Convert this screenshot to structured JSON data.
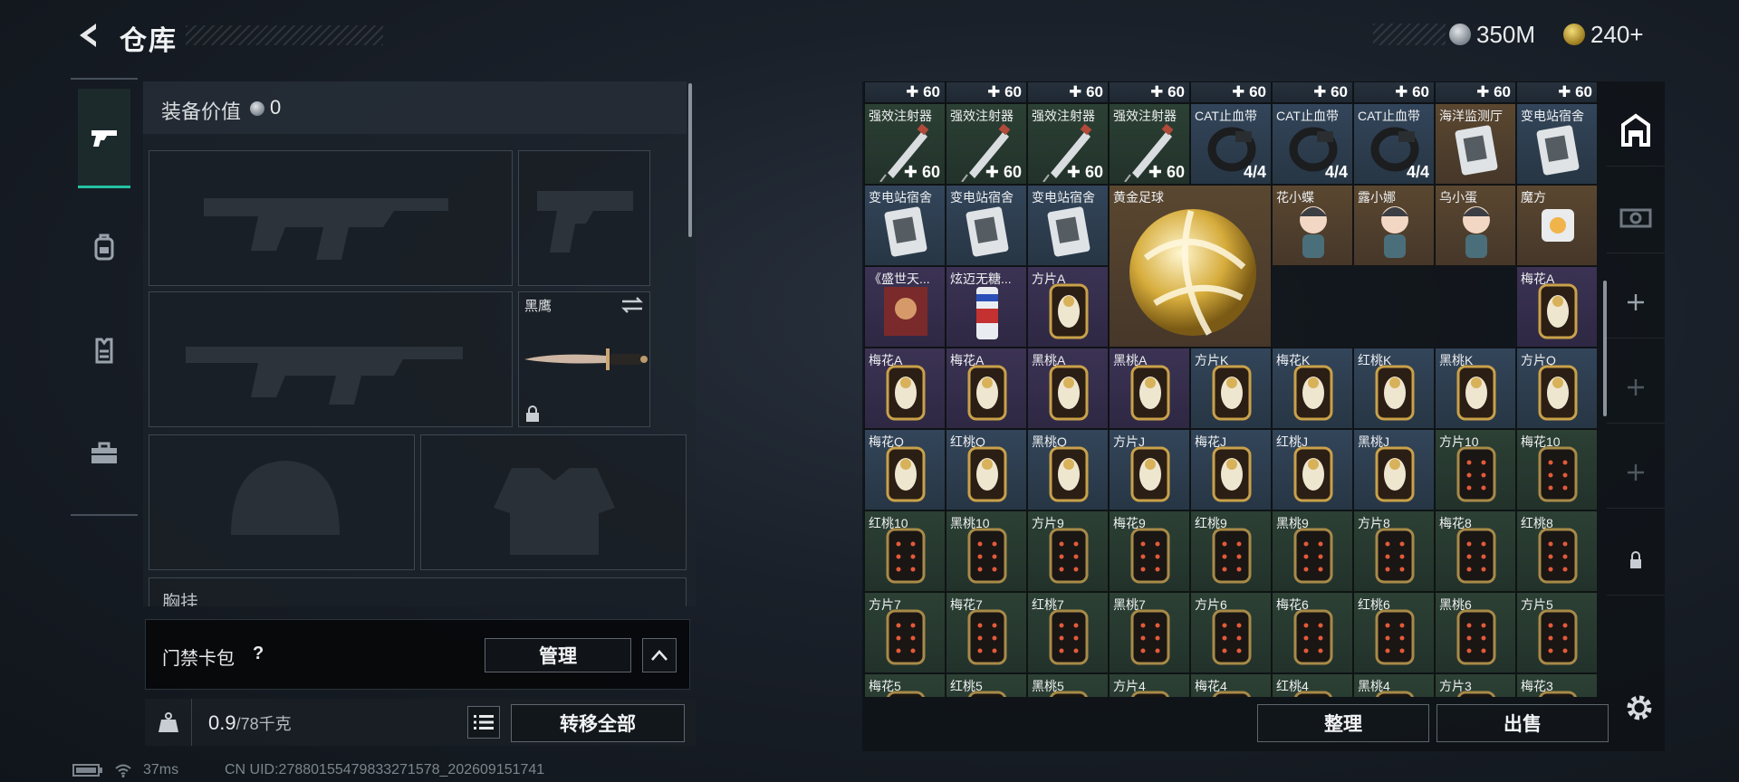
{
  "header": {
    "title": "仓库",
    "currency": [
      {
        "icon": "silver-coin-icon",
        "value": "350M"
      },
      {
        "icon": "gold-coin-icon",
        "value": "240+"
      }
    ]
  },
  "left_nav": [
    {
      "icon": "pistol-icon",
      "active": true
    },
    {
      "icon": "backpack-icon",
      "active": false
    },
    {
      "icon": "vest-icon",
      "active": false
    },
    {
      "icon": "toolbox-icon",
      "active": false
    }
  ],
  "equipment": {
    "value_label": "装备价值",
    "value": "0",
    "melee_name": "黑鹰",
    "chest_label": "胸挂"
  },
  "keycard": {
    "label": "门禁卡包",
    "help": "?",
    "manage_label": "管理"
  },
  "weight": {
    "current": "0.9",
    "max": "/78千克",
    "transfer_label": "转移全部"
  },
  "status": {
    "ping": "37ms",
    "uid": "CN UID:2788015547983327157​8_202609151741"
  },
  "storage": {
    "top_counts": [
      "60",
      "60",
      "60",
      "60",
      "60",
      "60",
      "60",
      "60",
      "60"
    ],
    "rows": [
      [
        {
          "name": "强效注射器",
          "count": "60",
          "art": "syringe",
          "tone": "green"
        },
        {
          "name": "强效注射器",
          "count": "60",
          "art": "syringe",
          "tone": "green"
        },
        {
          "name": "强效注射器",
          "count": "60",
          "art": "syringe",
          "tone": "green"
        },
        {
          "name": "强效注射器",
          "count": "60",
          "art": "syringe",
          "tone": "green"
        },
        {
          "name": "CAT止血带",
          "count": "4/4",
          "art": "tourniquet",
          "tone": "blue"
        },
        {
          "name": "CAT止血带",
          "count": "4/4",
          "art": "tourniquet",
          "tone": "blue"
        },
        {
          "name": "CAT止血带",
          "count": "4/4",
          "art": "tourniquet",
          "tone": "blue"
        },
        {
          "name": "海洋监测厅",
          "count": "",
          "art": "bag",
          "tone": "gold"
        },
        {
          "name": "变电站宿舍",
          "count": "",
          "art": "bag",
          "tone": "blue"
        }
      ],
      [
        {
          "name": "变电站宿舍",
          "count": "",
          "art": "bag",
          "tone": "blue"
        },
        {
          "name": "变电站宿舍",
          "count": "",
          "art": "bag",
          "tone": "blue"
        },
        {
          "name": "变电站宿舍",
          "count": "",
          "art": "bag",
          "tone": "blue"
        },
        {
          "name": "黄金足球",
          "count": "",
          "art": "ball",
          "tone": "gold"
        },
        {
          "name": "",
          "count": "",
          "art": "none",
          "tone": "gold"
        },
        {
          "name": "花小蝶",
          "count": "",
          "art": "figure",
          "tone": "gold"
        },
        {
          "name": "露小娜",
          "count": "",
          "art": "figure",
          "tone": "gold"
        },
        {
          "name": "乌小蛋",
          "count": "",
          "art": "figure",
          "tone": "gold"
        },
        {
          "name": "魔方",
          "count": "",
          "art": "cube",
          "tone": "gold"
        }
      ],
      [
        {
          "name": "《盛世天...",
          "count": "",
          "art": "album",
          "tone": "purple"
        },
        {
          "name": "炫迈无糖...",
          "count": "",
          "art": "gum",
          "tone": "purple"
        },
        {
          "name": "方片A",
          "count": "",
          "art": "card-gold",
          "tone": "purple"
        },
        {
          "name": "",
          "count": "",
          "art": "none",
          "tone": "gold"
        },
        {
          "name": "",
          "count": "",
          "art": "none",
          "tone": "gold"
        },
        {
          "name": "",
          "count": "",
          "art": "none",
          "tone": "gold"
        },
        {
          "name": "",
          "count": "",
          "art": "none",
          "tone": "gold"
        },
        {
          "name": "",
          "count": "",
          "art": "none",
          "tone": "gold"
        },
        {
          "name": "梅花A",
          "count": "",
          "art": "card-gold",
          "tone": "purple"
        }
      ],
      [
        {
          "name": "梅花A",
          "count": "",
          "art": "card-gold",
          "tone": "purple"
        },
        {
          "name": "梅花A",
          "count": "",
          "art": "card-gold",
          "tone": "purple"
        },
        {
          "name": "黑桃A",
          "count": "",
          "art": "card-gold",
          "tone": "purple"
        },
        {
          "name": "黑桃A",
          "count": "",
          "art": "card-gold",
          "tone": "purple"
        },
        {
          "name": "方片K",
          "count": "",
          "art": "card-gold",
          "tone": "blue"
        },
        {
          "name": "梅花K",
          "count": "",
          "art": "card-gold",
          "tone": "blue"
        },
        {
          "name": "红桃K",
          "count": "",
          "art": "card-gold",
          "tone": "blue"
        },
        {
          "name": "黑桃K",
          "count": "",
          "art": "card-gold",
          "tone": "blue"
        },
        {
          "name": "方片Q",
          "count": "",
          "art": "card-gold",
          "tone": "blue"
        }
      ],
      [
        {
          "name": "梅花Q",
          "count": "",
          "art": "card-gold",
          "tone": "blue"
        },
        {
          "name": "红桃Q",
          "count": "",
          "art": "card-gold",
          "tone": "blue"
        },
        {
          "name": "黑桃Q",
          "count": "",
          "art": "card-gold",
          "tone": "blue"
        },
        {
          "name": "方片J",
          "count": "",
          "art": "card-gold",
          "tone": "blue"
        },
        {
          "name": "梅花J",
          "count": "",
          "art": "card-gold",
          "tone": "blue"
        },
        {
          "name": "红桃J",
          "count": "",
          "art": "card-gold",
          "tone": "blue"
        },
        {
          "name": "黑桃J",
          "count": "",
          "art": "card-gold",
          "tone": "blue"
        },
        {
          "name": "方片10",
          "count": "",
          "art": "card-dark",
          "tone": "green"
        },
        {
          "name": "梅花10",
          "count": "",
          "art": "card-dark",
          "tone": "green"
        }
      ],
      [
        {
          "name": "红桃10",
          "count": "",
          "art": "card-dark",
          "tone": "green"
        },
        {
          "name": "黑桃10",
          "count": "",
          "art": "card-dark",
          "tone": "green"
        },
        {
          "name": "方片9",
          "count": "",
          "art": "card-dark",
          "tone": "green"
        },
        {
          "name": "梅花9",
          "count": "",
          "art": "card-dark",
          "tone": "green"
        },
        {
          "name": "红桃9",
          "count": "",
          "art": "card-dark",
          "tone": "green"
        },
        {
          "name": "黑桃9",
          "count": "",
          "art": "card-dark",
          "tone": "green"
        },
        {
          "name": "方片8",
          "count": "",
          "art": "card-dark",
          "tone": "green"
        },
        {
          "name": "梅花8",
          "count": "",
          "art": "card-dark",
          "tone": "green"
        },
        {
          "name": "红桃8",
          "count": "",
          "art": "card-dark",
          "tone": "green"
        }
      ],
      [
        {
          "name": "方片7",
          "count": "",
          "art": "card-dark",
          "tone": "green"
        },
        {
          "name": "梅花7",
          "count": "",
          "art": "card-dark",
          "tone": "green"
        },
        {
          "name": "红桃7",
          "count": "",
          "art": "card-dark",
          "tone": "green"
        },
        {
          "name": "黑桃7",
          "count": "",
          "art": "card-dark",
          "tone": "green"
        },
        {
          "name": "方片6",
          "count": "",
          "art": "card-dark",
          "tone": "green"
        },
        {
          "name": "梅花6",
          "count": "",
          "art": "card-dark",
          "tone": "green"
        },
        {
          "name": "红桃6",
          "count": "",
          "art": "card-dark",
          "tone": "green"
        },
        {
          "name": "黑桃6",
          "count": "",
          "art": "card-dark",
          "tone": "green"
        },
        {
          "name": "方片5",
          "count": "",
          "art": "card-dark",
          "tone": "green"
        }
      ],
      [
        {
          "name": "梅花5",
          "count": "",
          "art": "card-dark",
          "tone": "green"
        },
        {
          "name": "红桃5",
          "count": "",
          "art": "card-dark",
          "tone": "green"
        },
        {
          "name": "黑桃5",
          "count": "",
          "art": "card-dark",
          "tone": "green"
        },
        {
          "name": "方片4",
          "count": "",
          "art": "card-dark",
          "tone": "green"
        },
        {
          "name": "梅花4",
          "count": "",
          "art": "card-dark",
          "tone": "green"
        },
        {
          "name": "红桃4",
          "count": "",
          "art": "card-dark",
          "tone": "green"
        },
        {
          "name": "黑桃4",
          "count": "",
          "art": "card-dark",
          "tone": "green"
        },
        {
          "name": "方片3",
          "count": "",
          "art": "card-dark",
          "tone": "green"
        },
        {
          "name": "梅花3",
          "count": "",
          "art": "card-dark",
          "tone": "green"
        }
      ]
    ],
    "sort_label": "整理",
    "sell_label": "出售",
    "tools": [
      "storage-icon",
      "vehicle-icon",
      "plus-icon",
      "plus-icon",
      "plus-icon",
      "lock-icon"
    ]
  }
}
